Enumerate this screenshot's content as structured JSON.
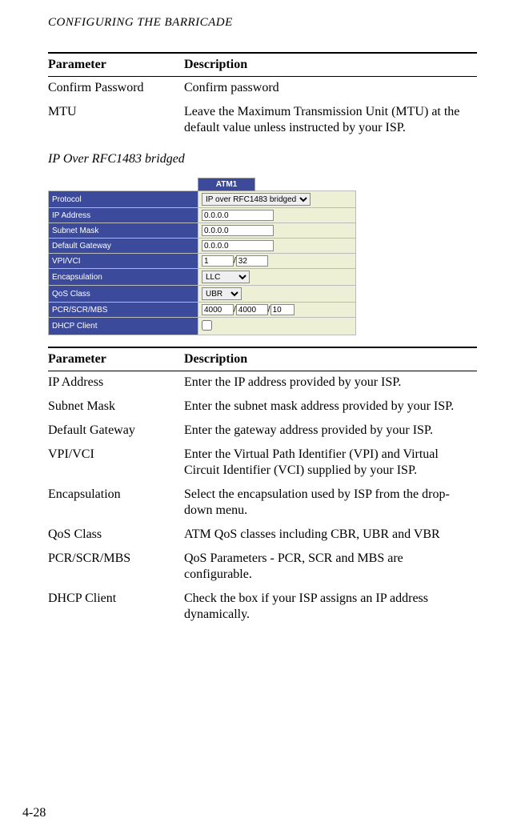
{
  "running_header": "CONFIGURING THE BARRICADE",
  "page_number": "4-28",
  "table1": {
    "headers": {
      "param": "Parameter",
      "desc": "Description"
    },
    "rows": [
      {
        "param": "Confirm Password",
        "desc": "Confirm password"
      },
      {
        "param": "MTU",
        "desc": "Leave the Maximum Transmission Unit (MTU) at the default value unless instructed by your ISP."
      }
    ]
  },
  "section_title": "IP Over RFC1483 bridged",
  "shot": {
    "column_header": "ATM1",
    "rows": {
      "protocol": {
        "label": "Protocol",
        "value": "IP over RFC1483 bridged"
      },
      "ip": {
        "label": "IP Address",
        "value": "0.0.0.0"
      },
      "subnet": {
        "label": "Subnet Mask",
        "value": "0.0.0.0"
      },
      "gateway": {
        "label": "Default Gateway",
        "value": "0.0.0.0"
      },
      "vpivci": {
        "label": "VPI/VCI",
        "vpi": "1",
        "vci": "32"
      },
      "encap": {
        "label": "Encapsulation",
        "value": "LLC"
      },
      "qos": {
        "label": "QoS Class",
        "value": "UBR"
      },
      "pcr": {
        "label": "PCR/SCR/MBS",
        "pcr": "4000",
        "scr": "4000",
        "mbs": "10"
      },
      "dhcp": {
        "label": "DHCP Client"
      }
    }
  },
  "table2": {
    "headers": {
      "param": "Parameter",
      "desc": "Description"
    },
    "rows": [
      {
        "param": "IP Address",
        "desc": "Enter the IP address provided by your ISP."
      },
      {
        "param": "Subnet Mask",
        "desc": "Enter the subnet mask address provided by your ISP."
      },
      {
        "param": "Default Gateway",
        "desc": "Enter the gateway address provided by your ISP."
      },
      {
        "param": "VPI/VCI",
        "desc": "Enter the Virtual Path Identifier (VPI) and Virtual Circuit Identifier (VCI) supplied by your ISP."
      },
      {
        "param": "Encapsulation",
        "desc": "Select the encapsulation used by ISP from the drop-down menu."
      },
      {
        "param": "QoS Class",
        "desc": "ATM QoS classes including CBR, UBR and VBR"
      },
      {
        "param": "PCR/SCR/MBS",
        "desc": "QoS Parameters - PCR, SCR and MBS are configurable."
      },
      {
        "param": "DHCP Client",
        "desc": "Check the box if your ISP assigns an IP address dynamically."
      }
    ]
  }
}
